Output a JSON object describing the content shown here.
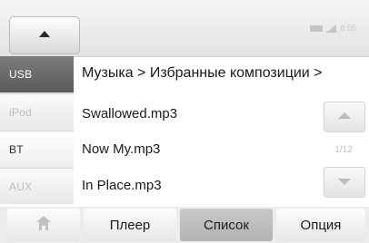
{
  "status": {
    "clock": "6:05"
  },
  "sources": [
    {
      "label": "USB",
      "state": "active"
    },
    {
      "label": "iPod",
      "state": "dim"
    },
    {
      "label": "BT",
      "state": "normal"
    },
    {
      "label": "AUX",
      "state": "dim"
    }
  ],
  "list": {
    "breadcrumb": "Музыка > Избранные композиции >",
    "items": [
      "Swallowed.mp3",
      "Now My.mp3",
      "In Place.mp3"
    ],
    "page_indicator": "1/12"
  },
  "bottom_tabs": {
    "player": "Плеер",
    "list": "Список",
    "options": "Опция",
    "selected": "list"
  },
  "icons": {
    "collapse": "triangle-up-icon",
    "home": "home-icon",
    "battery": "battery-icon",
    "signal": "signal-icon",
    "scroll_up": "scroll-up-icon",
    "scroll_down": "scroll-down-icon"
  },
  "colors": {
    "active_source_bg": "#6b6b6b",
    "selected_tab_bg": "#bdbdbd",
    "text": "#1a1a1a",
    "dimmed": "#bdbdbd"
  }
}
